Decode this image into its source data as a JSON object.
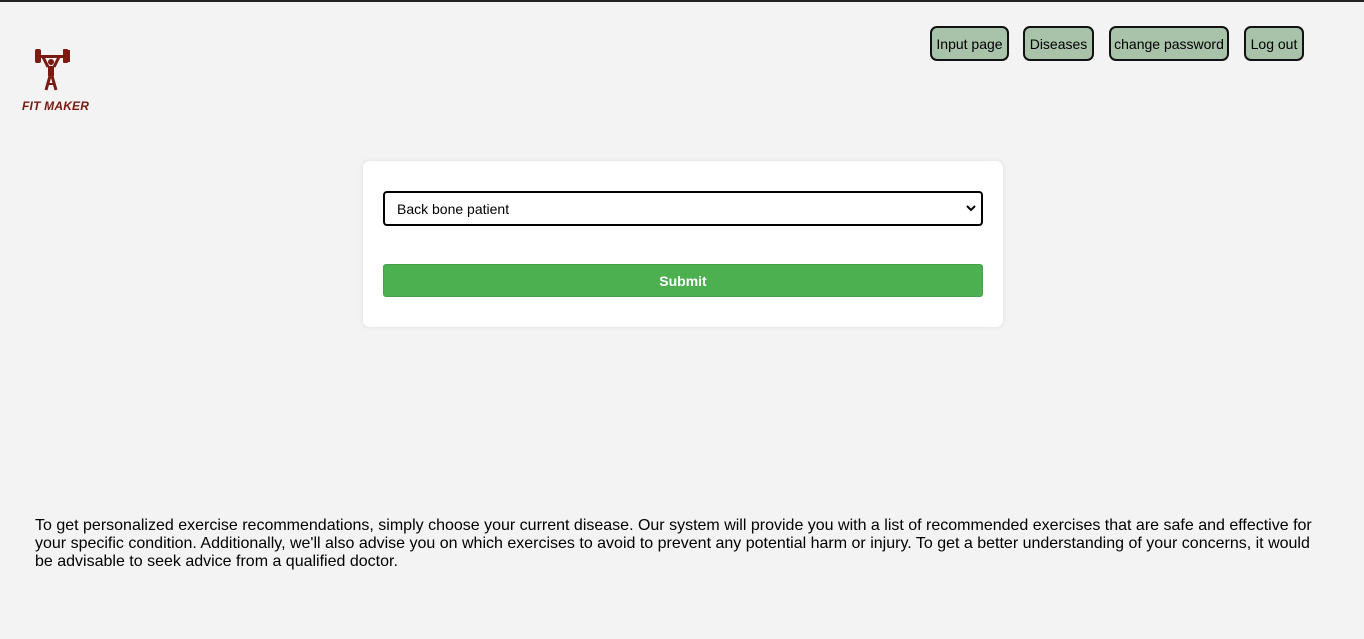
{
  "logo": {
    "text": "FIT MAKER",
    "color": "#7a1a10"
  },
  "nav": {
    "items": [
      {
        "label": "Input page"
      },
      {
        "label": "Diseases"
      },
      {
        "label": "change password"
      },
      {
        "label": "Log out"
      }
    ],
    "button_color": "#a8c3aa"
  },
  "form": {
    "select_value": "Back bone patient",
    "submit_label": "Submit",
    "submit_color": "#4caf50"
  },
  "info_text": "To get personalized exercise recommendations, simply choose your current disease. Our system will provide you with a list of recommended exercises that are safe and effective for your specific condition. Additionally, we'll also advise you on which exercises to avoid to prevent any potential harm or injury. To get a better understanding of your concerns, it would be advisable to seek advice from a qualified doctor."
}
